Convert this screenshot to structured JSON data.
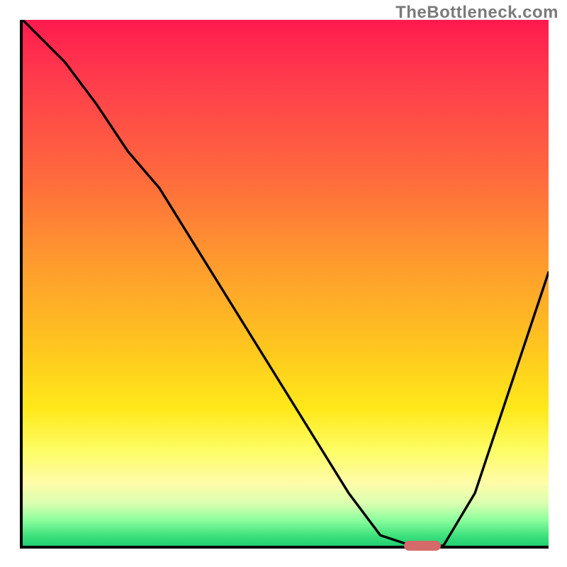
{
  "watermark": "TheBottleneck.com",
  "colors": {
    "axis": "#000000",
    "curve": "#000000",
    "marker": "#d46a6a",
    "gradient_stops": [
      "#ff1a4d",
      "#ff3b4d",
      "#ff6a3d",
      "#ff9a2e",
      "#ffc51f",
      "#ffe91a",
      "#fdfd66",
      "#fffca8",
      "#d9ffb0",
      "#8fff9e",
      "#40e27d",
      "#20d072"
    ]
  },
  "chart_data": {
    "type": "line",
    "title": "",
    "xlabel": "",
    "ylabel": "",
    "xlim": [
      0,
      100
    ],
    "ylim": [
      0,
      100
    ],
    "x": [
      0,
      8,
      14,
      20,
      26,
      62,
      68,
      74,
      80,
      86,
      92,
      100
    ],
    "values": [
      100,
      92,
      84,
      75,
      68,
      10,
      2,
      0,
      0,
      10,
      28,
      52
    ],
    "marker": {
      "x": 76,
      "y": 0,
      "width_pct": 7
    },
    "notes": "x is horizontal position as % of plot width (left→right); values is height above bottom as % of plot height; curve read from pixels, values approximate."
  }
}
